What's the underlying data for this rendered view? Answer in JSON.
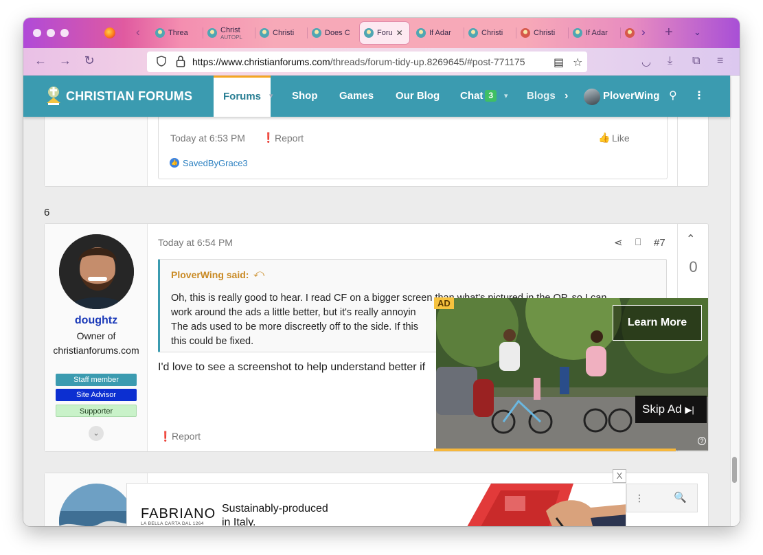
{
  "browser": {
    "tabs": [
      {
        "title": "Threa",
        "icon": "cf-favicon"
      },
      {
        "title": "Christ",
        "subtitle": "AUTOPL",
        "icon": "cf-favicon"
      },
      {
        "title": "Christi",
        "icon": "cf-favicon"
      },
      {
        "title": "Does C",
        "icon": "cf-favicon"
      },
      {
        "title": "Foru",
        "icon": "cf-favicon",
        "active": true,
        "close": "✕"
      },
      {
        "title": "If Adar",
        "icon": "cf-favicon"
      },
      {
        "title": "Christi",
        "icon": "cf-favicon"
      },
      {
        "title": "Christi",
        "icon": "cf-favicon-red"
      },
      {
        "title": "If Adar",
        "icon": "cf-favicon"
      }
    ],
    "url_host": "https://www.christianforums.com",
    "url_path": "/threads/forum-tidy-up.8269645/#post-771175"
  },
  "site": {
    "logo_text": "CHRISTIAN FORUMS",
    "nav": {
      "forums": "Forums",
      "shop": "Shop",
      "games": "Games",
      "blog": "Our Blog",
      "chat": "Chat",
      "chat_badge": "3",
      "blogs": "Blogs"
    },
    "username": "PloverWing"
  },
  "post6": {
    "time": "Today at 6:53 PM",
    "report": "Report",
    "like": "Like",
    "liked_by": "SavedByGrace3"
  },
  "between_label": "6",
  "post7": {
    "time": "Today at 6:54 PM",
    "number": "#7",
    "author": "doughtz",
    "author_title": "Owner of christianforums.com",
    "banners": {
      "staff": "Staff member",
      "advisor": "Site Advisor",
      "supporter": "Supporter"
    },
    "vote_count": "0",
    "quote_author": "PloverWing said:",
    "quote_line1": "Oh, this is really good to hear. I read CF on a bigger screen than what's pictured in the OP, so I can",
    "quote_line2": "work around the ads a little better, but it's really annoyin",
    "quote_line3": "The ads used to be more discreetly off to the side. If this",
    "quote_line4": "this could be fixed.",
    "body": "I'd love to see a screenshot to help understand better if",
    "report": "Report"
  },
  "video_ad": {
    "label": "AD",
    "learn_more": "Learn More",
    "skip": "Skip Ad",
    "progress": 0.89
  },
  "banner_ad": {
    "close": "X",
    "brand": "FABRIANO",
    "brand_sub": "LA BELLA CARTA DAL 1264",
    "copy_line1": "Sustainably-produced",
    "copy_line2": "in Italy."
  },
  "colors": {
    "header": "#3b9bb0",
    "accent": "#f5a623",
    "username": "#1a39b8",
    "staff": "#3b9bb0",
    "advisor": "#0c2fd1",
    "supporter": "#c9f2c9"
  }
}
